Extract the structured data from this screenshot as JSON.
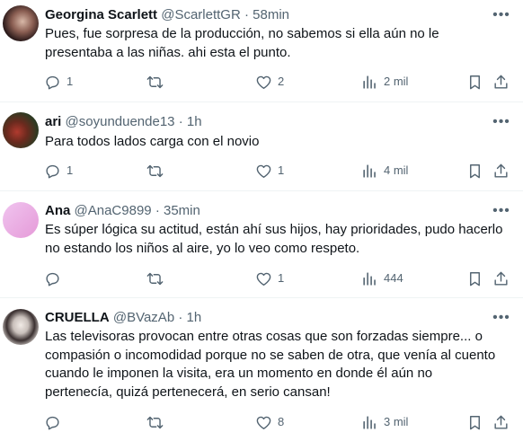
{
  "tweets": [
    {
      "name": "Georgina Scarlett",
      "handle": "@ScarlettGR",
      "sep": "·",
      "time": "58min",
      "text": "Pues, fue sorpresa de la producción, no sabemos si ella aún no le presentaba a las niñas. ahi esta el punto.",
      "replies": "1",
      "retweets": "",
      "likes": "2",
      "views": "2 mil"
    },
    {
      "name": "ari",
      "handle": "@soyunduende13",
      "sep": "·",
      "time": "1h",
      "text": "Para todos lados carga con el novio",
      "replies": "1",
      "retweets": "",
      "likes": "1",
      "views": "4 mil"
    },
    {
      "name": "Ana",
      "handle": "@AnaC9899",
      "sep": "·",
      "time": "35min",
      "text": "Es súper lógica su actitud, están ahí sus hijos, hay prioridades, pudo hacerlo no estando los niños al aire, yo lo veo como respeto.",
      "replies": "",
      "retweets": "",
      "likes": "1",
      "views": "444"
    },
    {
      "name": "CRUELLA",
      "handle": "@BVazAb",
      "sep": "·",
      "time": "1h",
      "text": "Las televisoras provocan entre otras cosas que son forzadas siempre... o compasión o incomodidad porque no se saben de otra, que venía al cuento cuando le imponen la visita, era un momento en donde él aún no pertenecía, quizá pertenecerá, en serio cansan!",
      "replies": "",
      "retweets": "",
      "likes": "8",
      "views": "3 mil"
    }
  ],
  "icons": {
    "reply": "reply-icon",
    "retweet": "retweet-icon",
    "like": "heart-icon",
    "views": "views-icon",
    "bookmark": "bookmark-icon",
    "share": "share-icon",
    "more": "more-icon"
  },
  "colors": {
    "text": "#0f1419",
    "secondary": "#536471",
    "divider": "#eff3f4"
  }
}
